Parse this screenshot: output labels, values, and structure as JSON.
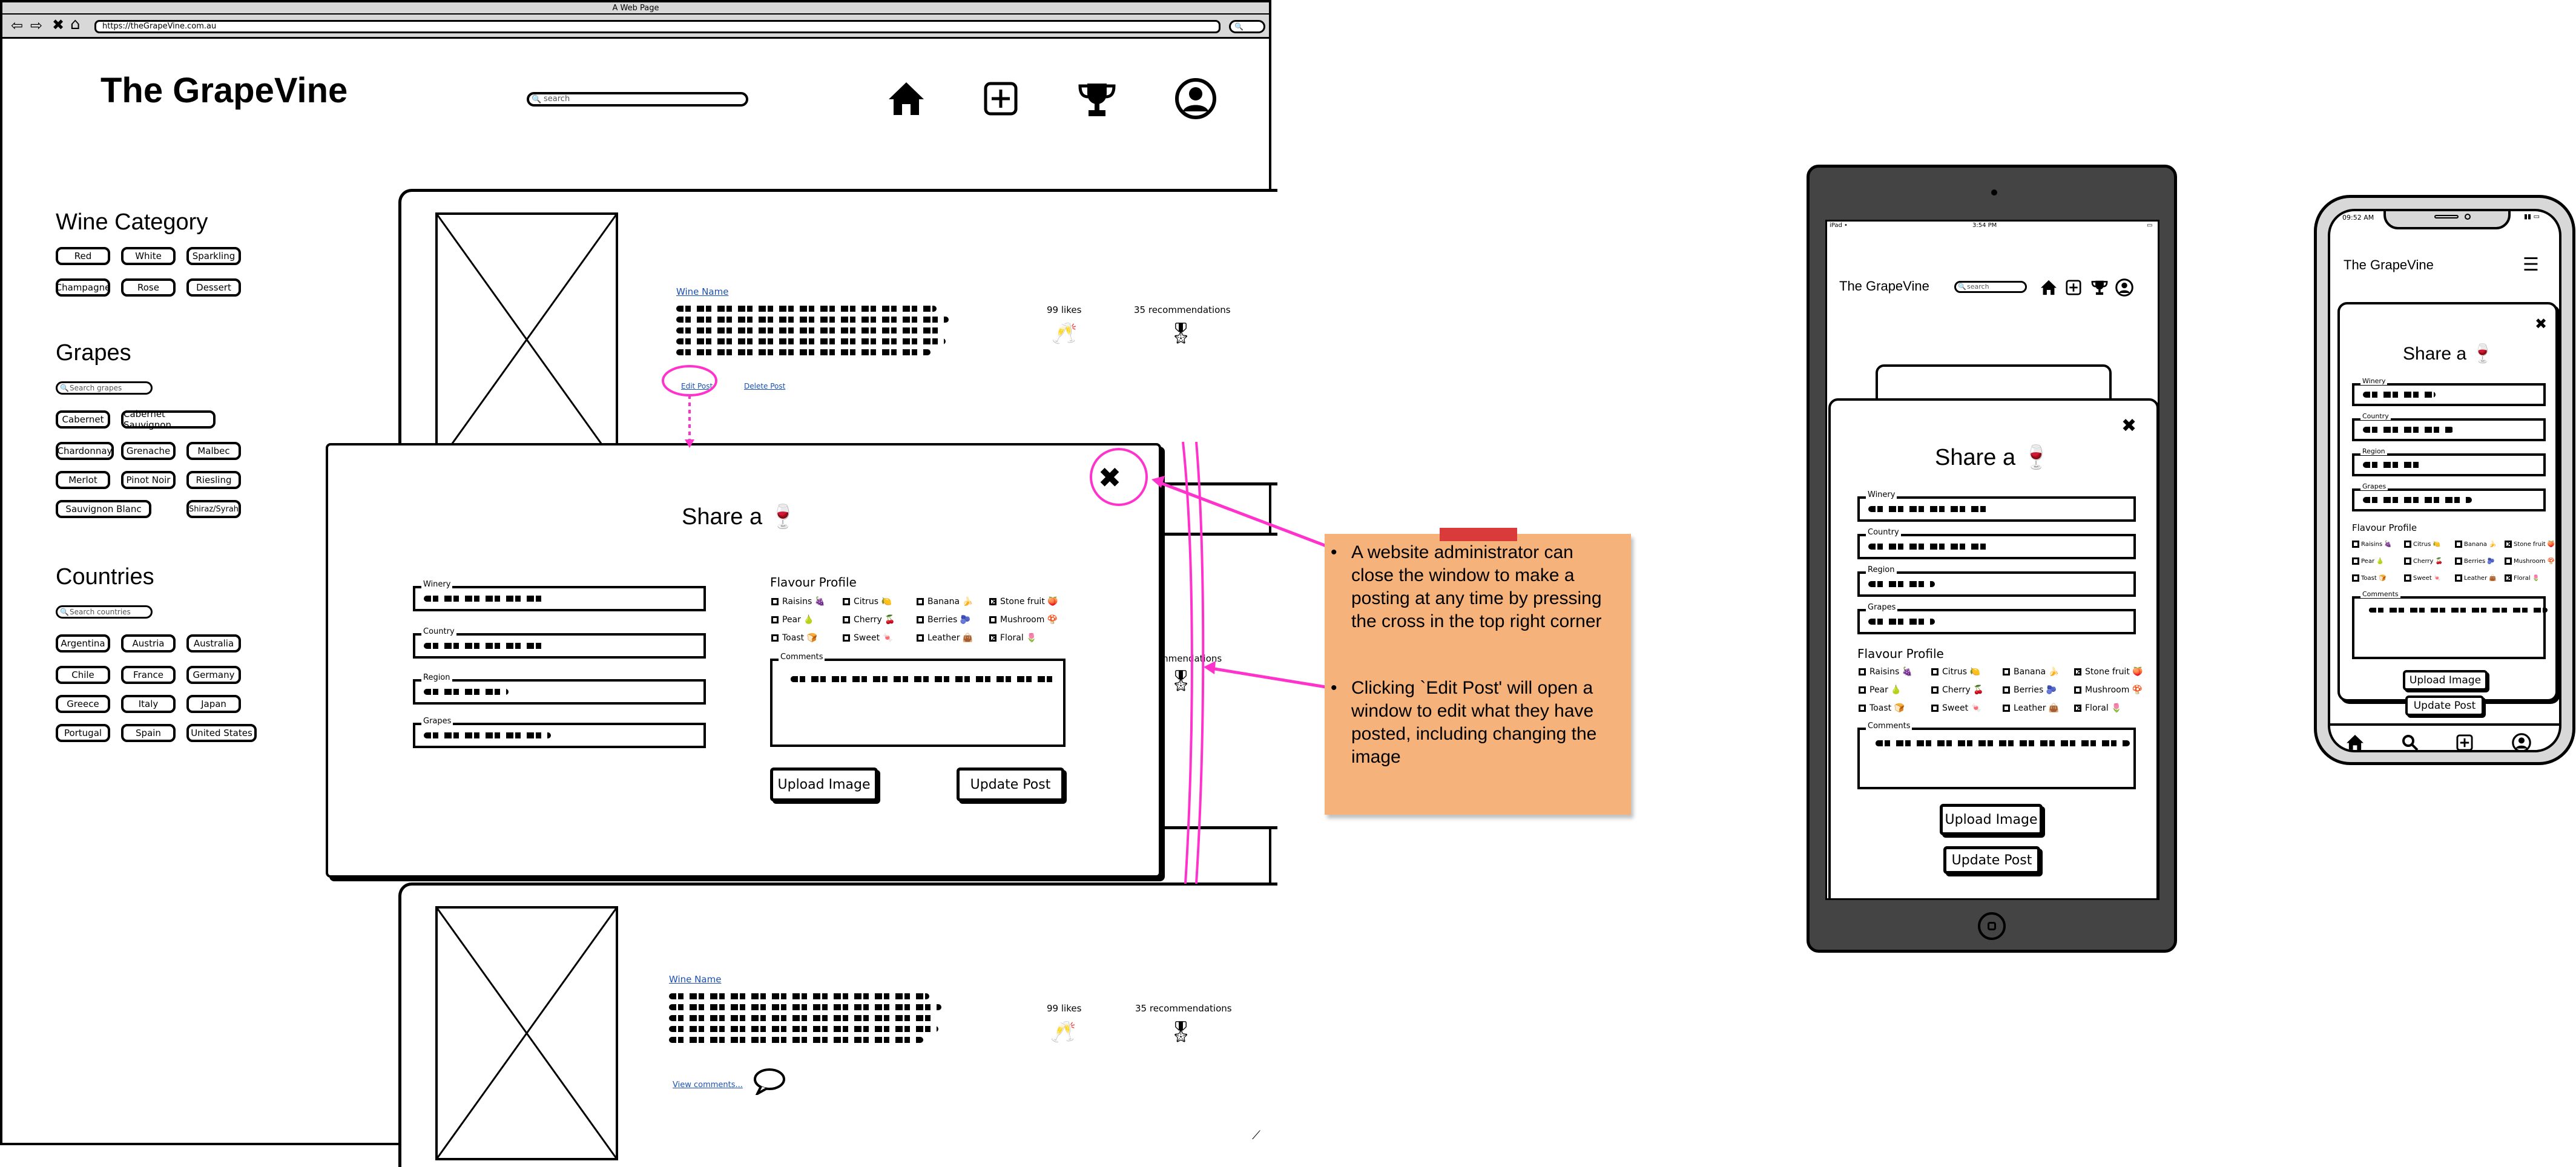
{
  "browser": {
    "title": "A Web Page",
    "url": "https://theGrapeVine.com.au"
  },
  "header": {
    "logo": "The GrapeVine",
    "search_placeholder": "search"
  },
  "sidebar": {
    "wine_category": {
      "title": "Wine Category",
      "items": [
        "Red",
        "White",
        "Sparkling",
        "Champagne",
        "Rose",
        "Dessert"
      ]
    },
    "grapes": {
      "title": "Grapes",
      "search_placeholder": "Search grapes",
      "items": [
        "Cabernet",
        "Cabernet Sauvignon",
        "Chardonnay",
        "Grenache",
        "Malbec",
        "Merlot",
        "Pinot Noir",
        "Riesling",
        "Sauvignon Blanc",
        "Shiraz/Syrah"
      ]
    },
    "countries": {
      "title": "Countries",
      "search_placeholder": "Search countries",
      "items": [
        "Argentina",
        "Austria",
        "Australia",
        "Chile",
        "France",
        "Germany",
        "Greece",
        "Italy",
        "Japan",
        "Portugal",
        "Spain",
        "United States"
      ]
    }
  },
  "posts": [
    {
      "wine_name": "Wine Name",
      "likes": "99 likes",
      "recommendations": "35 recommendations",
      "edit_link": "Edit Post",
      "delete_link": "Delete Post"
    },
    {
      "recommendations_partial": "mmendations"
    },
    {
      "wine_name": "Wine Name",
      "likes": "99 likes",
      "recommendations": "35 recommendations",
      "comments_link": "View comments..."
    }
  ],
  "modal": {
    "title": "Share a 🍷",
    "fields": [
      "Winery",
      "Country",
      "Region",
      "Grapes"
    ],
    "flavour_title": "Flavour Profile",
    "flavours": [
      {
        "label": "Raisins 🍇",
        "checked": false
      },
      {
        "label": "Citrus 🍋",
        "checked": false
      },
      {
        "label": "Banana 🍌",
        "checked": false
      },
      {
        "label": "Stone fruit 🍑",
        "checked": true
      },
      {
        "label": "Pear 🍐",
        "checked": false
      },
      {
        "label": "Cherry 🍒",
        "checked": false
      },
      {
        "label": "Berries 🫐",
        "checked": false
      },
      {
        "label": "Mushroom 🍄",
        "checked": false
      },
      {
        "label": "Toast 🍞",
        "checked": false
      },
      {
        "label": "Sweet 🍬",
        "checked": false
      },
      {
        "label": "Leather 👜",
        "checked": false
      },
      {
        "label": "Floral 🌷",
        "checked": true
      }
    ],
    "comments_label": "Comments",
    "upload_button": "Upload Image",
    "update_button": "Update Post",
    "close_icon": "close-x-icon"
  },
  "note": {
    "bullet1": "A website administrator can close the window to make a posting at any time by pressing the cross in the top right corner",
    "bullet2": "Clicking `Edit Post' will open a window to edit what they have posted, including changing the image"
  },
  "tablet": {
    "status_left": "iPad •",
    "status_time": "3:54 PM",
    "logo": "The GrapeVine",
    "search_placeholder": "search"
  },
  "phone": {
    "status_time": "09:52 AM",
    "logo": "The GrapeVine"
  },
  "colors": {
    "accent_magenta": "#ff33cc",
    "note_orange": "#f5b27a",
    "device_frame": "#444444",
    "browser_chrome": "#d8d8d8"
  },
  "icons": {
    "nav": [
      "home-icon",
      "add-icon",
      "trophy-icon",
      "user-icon"
    ],
    "likes": "wine-glasses-icon",
    "recommendations": "medal-icon",
    "comments": "speech-bubble-icon"
  }
}
